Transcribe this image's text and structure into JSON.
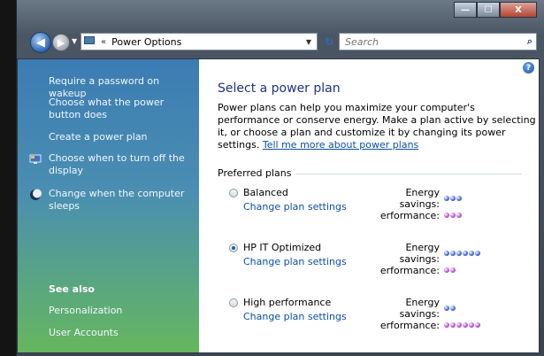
{
  "window": {
    "min_label": "—",
    "max_label": "☐",
    "close_label": "X"
  },
  "nav": {
    "back_glyph": "◀",
    "fwd_glyph": "▶",
    "breadcrumb_chevron": "«",
    "address_text": "Power Options",
    "refresh_glyph": "↻",
    "search_placeholder": "Search",
    "search_glyph": "⌕"
  },
  "sidebar": {
    "links": [
      {
        "label": "Require a password on wakeup",
        "icon": null
      },
      {
        "label": "Choose what the power button does",
        "icon": null
      },
      {
        "label": "Create a power plan",
        "icon": null
      },
      {
        "label": "Choose when to turn off the display",
        "icon": "monitor-icon"
      },
      {
        "label": "Change when the computer sleeps",
        "icon": "moon-icon"
      }
    ],
    "see_also": "See also",
    "see_also_links": [
      "Personalization",
      "User Accounts"
    ]
  },
  "main": {
    "help_glyph": "?",
    "title": "Select a power plan",
    "intro_text": "Power plans can help you maximize your computer's performance or conserve energy. Make a plan active by selecting it, or choose a plan and customize it by changing its power settings. ",
    "intro_link": "Tell me more about power plans",
    "group_label": "Preferred plans",
    "plans": [
      {
        "name": "Balanced",
        "link": "Change plan settings",
        "checked": false,
        "energy_dots": 3,
        "perf_dots": 3
      },
      {
        "name": "HP IT Optimized",
        "link": "Change plan settings",
        "checked": true,
        "energy_dots": 6,
        "perf_dots": 2
      },
      {
        "name": "High performance",
        "link": "Change plan settings",
        "checked": false,
        "energy_dots": 2,
        "perf_dots": 6
      }
    ],
    "energy_label_1": "Energy",
    "energy_label_2": "savings:",
    "perf_label": "erformance:"
  },
  "colors": {
    "energy_dot": "#3b5fd6",
    "perf_dot": "#b04ac8",
    "link": "#0b4fa8",
    "title": "#1e3287"
  }
}
